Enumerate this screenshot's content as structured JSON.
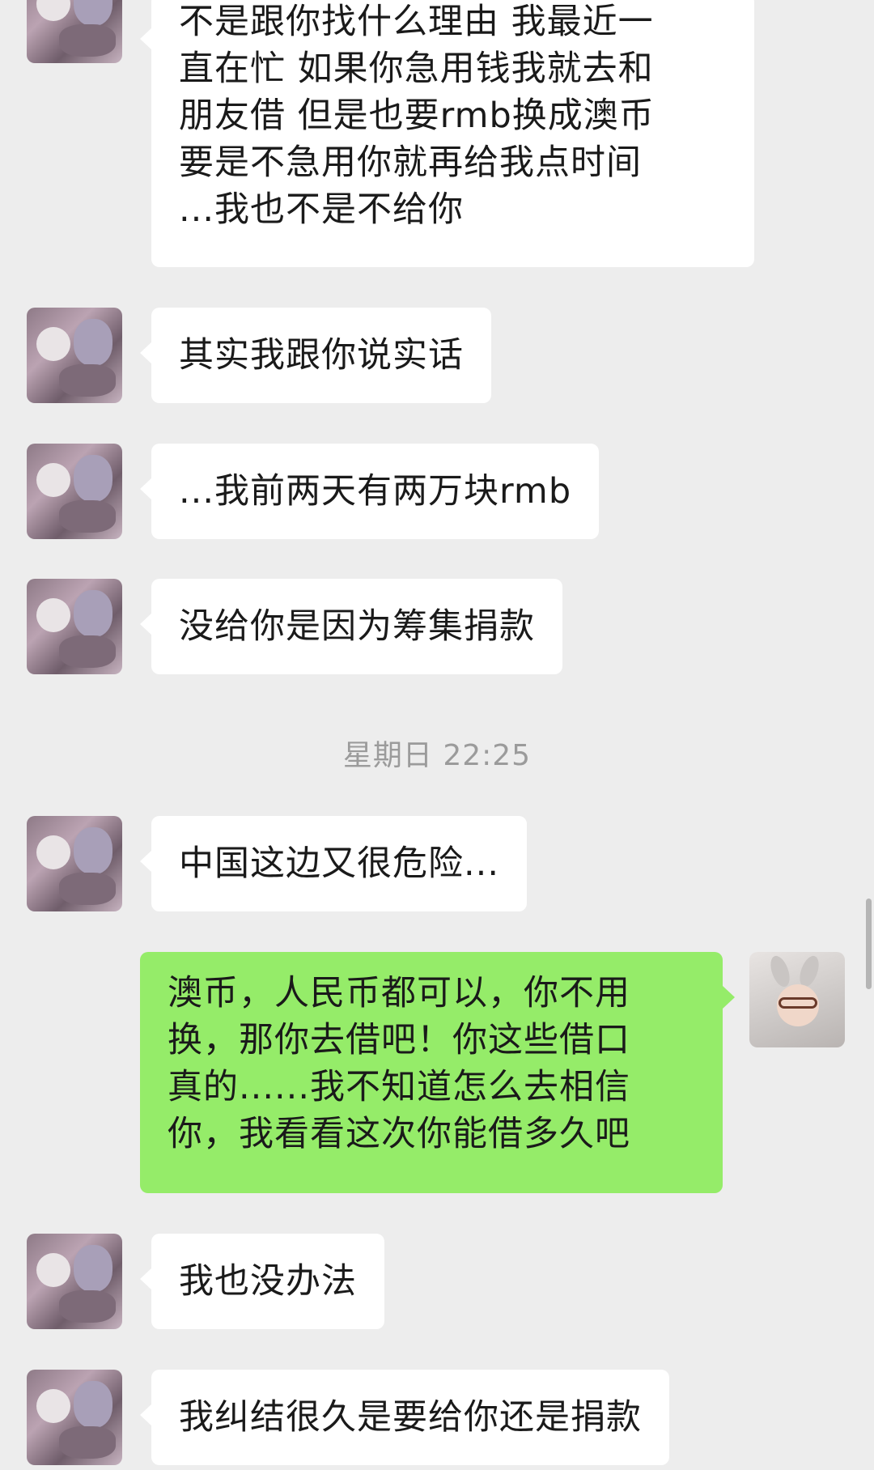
{
  "messages": [
    {
      "side": "left",
      "text": "不是跟你找什么理由 我最近一\n直在忙 如果你急用钱我就去和\n朋友借 但是也要rmb换成澳币\n要是不急用你就再给我点时间\n...我也不是不给你"
    },
    {
      "side": "left",
      "text": "其实我跟你说实话"
    },
    {
      "side": "left",
      "text": "...我前两天有两万块rmb"
    },
    {
      "side": "left",
      "text": "没给你是因为筹集捐款"
    },
    {
      "side": "left",
      "text": "中国这边又很危险..."
    },
    {
      "side": "right",
      "text": "澳币，人民币都可以，你不用\n换，那你去借吧！你这些借口\n真的......我不知道怎么去相信\n你，我看看这次你能借多久吧"
    },
    {
      "side": "left",
      "text": "我也没办法"
    },
    {
      "side": "left",
      "text": "我纠结很久是要给你还是捐款"
    }
  ],
  "timestamp": "星期日 22:25",
  "colors": {
    "background": "#ededed",
    "incoming_bubble": "#ffffff",
    "outgoing_bubble": "#95ec69",
    "timestamp_text": "#9b9b9b"
  }
}
